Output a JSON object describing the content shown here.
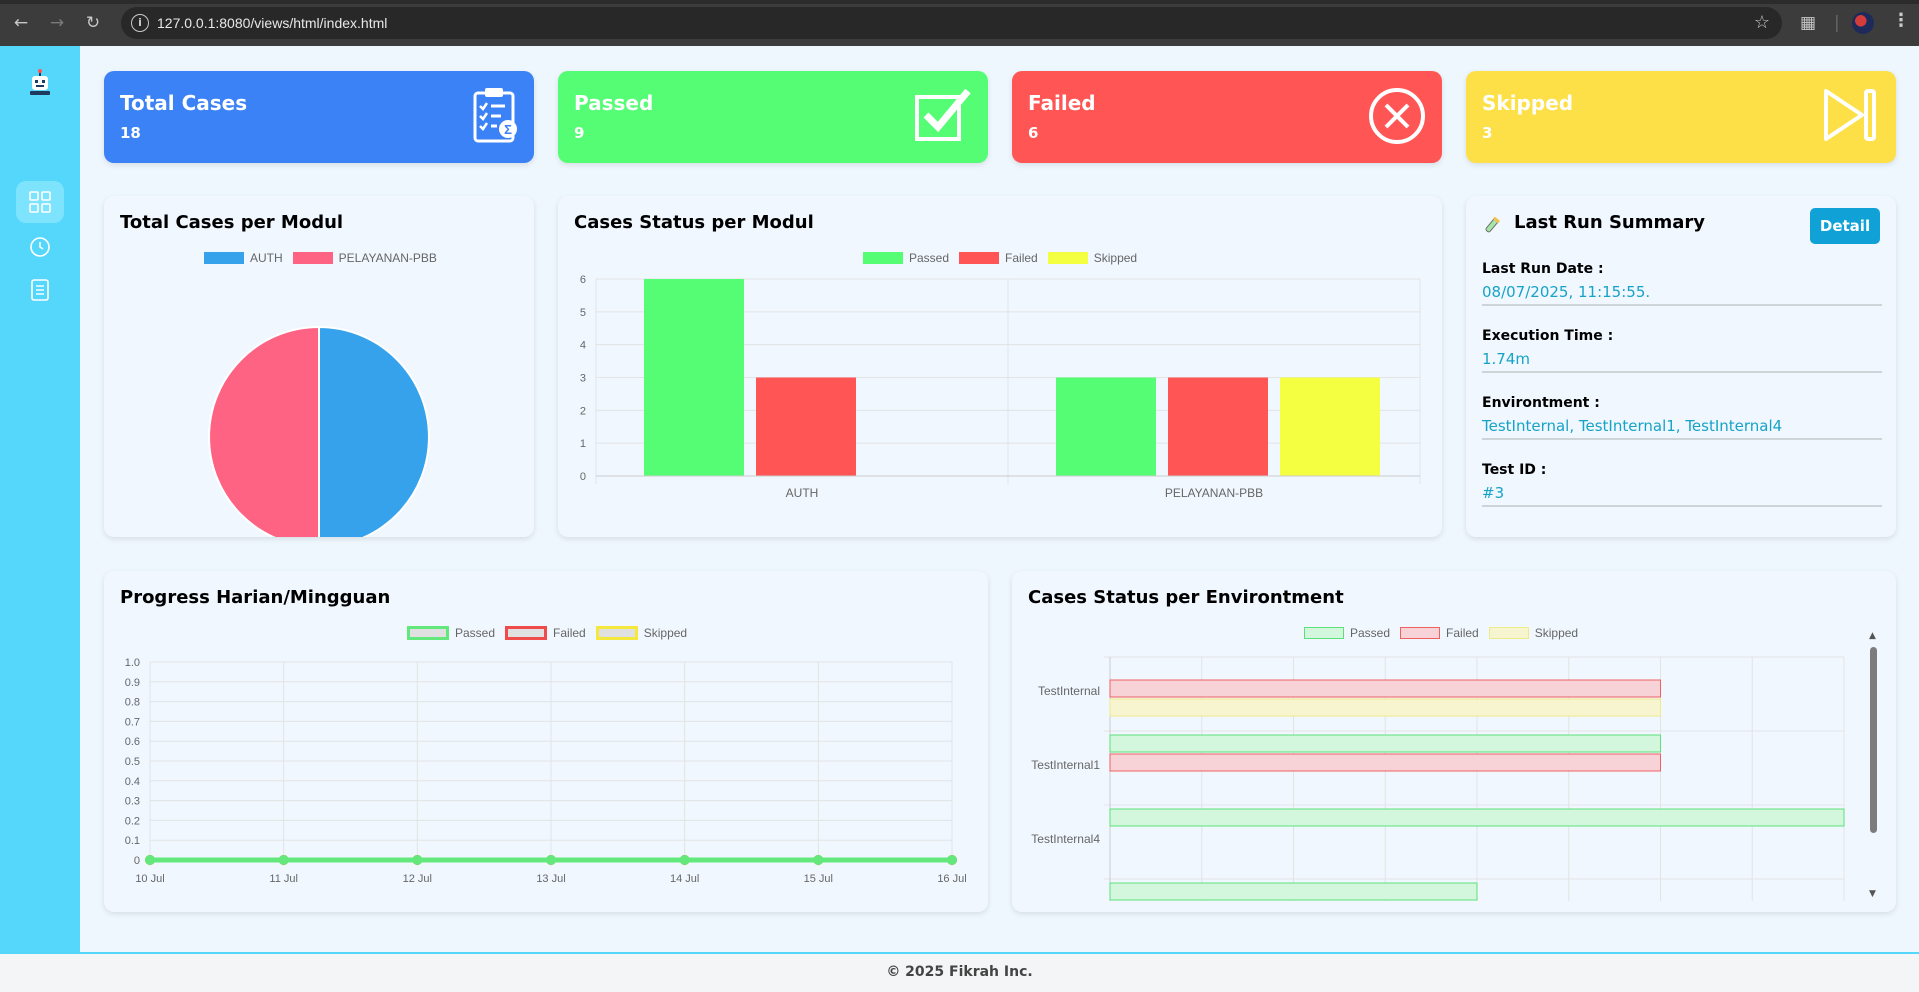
{
  "browser": {
    "url": "127.0.0.1:8080/views/html/index.html",
    "back_icon": "back-arrow-icon",
    "forward_icon": "forward-arrow-icon",
    "reload_icon": "reload-icon"
  },
  "stats": {
    "total": {
      "title": "Total Cases",
      "value": "18",
      "color": "#3b82f6",
      "icon": "clipboard-list-icon"
    },
    "passed": {
      "title": "Passed",
      "value": "9",
      "color": "#54fd74",
      "icon": "checkbox-checked-icon"
    },
    "failed": {
      "title": "Failed",
      "value": "6",
      "color": "#ff5555",
      "icon": "circle-x-icon"
    },
    "skipped": {
      "title": "Skipped",
      "value": "3",
      "color": "#fde047",
      "icon": "skip-forward-icon"
    }
  },
  "pie": {
    "title": "Total Cases per Modul",
    "legend": [
      {
        "label": "AUTH",
        "color": "#36a2eb"
      },
      {
        "label": "PELAYANAN-PBB",
        "color": "#ff6384"
      }
    ]
  },
  "bar": {
    "title": "Cases Status per Modul",
    "legend": [
      {
        "label": "Passed",
        "color": "#54fd74"
      },
      {
        "label": "Failed",
        "color": "#ff5555"
      },
      {
        "label": "Skipped",
        "color": "#f5ff42"
      }
    ]
  },
  "summary": {
    "title": "Last Run Summary",
    "title_icon": "test-tube-icon",
    "detail_label": "Detail",
    "rows": [
      {
        "label": "Last Run Date :",
        "value": "08/07/2025, 11:15:55."
      },
      {
        "label": "Execution Time :",
        "value": "1.74m"
      },
      {
        "label": "Environtment :",
        "value": "TestInternal, TestInternal1, TestInternal4"
      },
      {
        "label": "Test ID :",
        "value": "#3"
      }
    ]
  },
  "line": {
    "title": "Progress Harian/Mingguan",
    "legend": [
      {
        "label": "Passed",
        "color": "#63e97b"
      },
      {
        "label": "Failed",
        "color": "#f04b4b"
      },
      {
        "label": "Skipped",
        "color": "#f5e83c"
      }
    ]
  },
  "env": {
    "title": "Cases Status per Environtment",
    "legend": [
      {
        "label": "Passed",
        "color": "#5de07a"
      },
      {
        "label": "Failed",
        "color": "#f06060"
      },
      {
        "label": "Skipped",
        "color": "#eeeb8a"
      }
    ]
  },
  "footer": {
    "text": "© 2025 Fikrah Inc."
  },
  "chart_data": [
    {
      "type": "pie",
      "title": "Total Cases per Modul",
      "categories": [
        "AUTH",
        "PELAYANAN-PBB"
      ],
      "values": [
        9,
        9
      ]
    },
    {
      "type": "bar",
      "title": "Cases Status per Modul",
      "categories": [
        "AUTH",
        "PELAYANAN-PBB"
      ],
      "series": [
        {
          "name": "Passed",
          "values": [
            6,
            3
          ]
        },
        {
          "name": "Failed",
          "values": [
            3,
            3
          ]
        },
        {
          "name": "Skipped",
          "values": [
            0,
            3
          ]
        }
      ],
      "ylim": [
        0,
        6
      ],
      "yticks": [
        "0",
        "1",
        "2",
        "3",
        "4",
        "5",
        "6"
      ]
    },
    {
      "type": "line",
      "title": "Progress Harian/Mingguan",
      "categories": [
        "10 Jul",
        "11 Jul",
        "12 Jul",
        "13 Jul",
        "14 Jul",
        "15 Jul",
        "16 Jul"
      ],
      "series": [
        {
          "name": "Passed",
          "values": [
            0,
            0,
            0,
            0,
            0,
            0,
            0
          ]
        },
        {
          "name": "Failed",
          "values": [
            0,
            0,
            0,
            0,
            0,
            0,
            0
          ]
        },
        {
          "name": "Skipped",
          "values": [
            0,
            0,
            0,
            0,
            0,
            0,
            0
          ]
        }
      ],
      "ylim": [
        0,
        1
      ],
      "yticks": [
        "0",
        "0.1",
        "0.2",
        "0.3",
        "0.4",
        "0.5",
        "0.6",
        "0.7",
        "0.8",
        "0.9",
        "1.0"
      ]
    },
    {
      "type": "bar",
      "orientation": "horizontal",
      "title": "Cases Status per Environtment",
      "categories": [
        "TestInternal",
        "TestInternal1",
        "TestInternal4"
      ],
      "series": [
        {
          "name": "Passed",
          "values": [
            0,
            3,
            4
          ]
        },
        {
          "name": "Failed",
          "values": [
            3,
            3,
            0
          ]
        },
        {
          "name": "Skipped",
          "values": [
            3,
            0,
            0
          ]
        }
      ],
      "extra_partial_bar": {
        "series": "Passed",
        "value": 2
      }
    }
  ]
}
